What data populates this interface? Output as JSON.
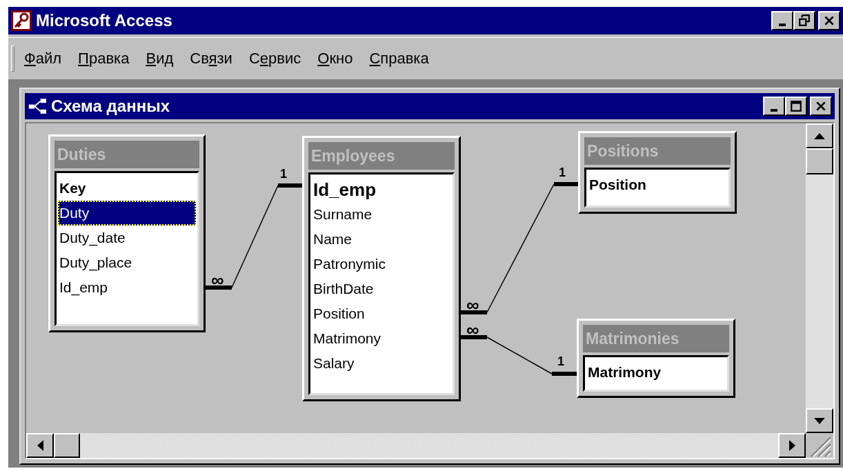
{
  "window": {
    "title": "Microsoft Access"
  },
  "menu": [
    {
      "key": "Ф",
      "post": "айл"
    },
    {
      "key": "П",
      "post": "равка"
    },
    {
      "key": "В",
      "post": "ид"
    },
    {
      "pre": "Св",
      "key": "я",
      "post": "зи"
    },
    {
      "pre": "С",
      "key": "е",
      "post": "рвис"
    },
    {
      "key": "О",
      "post": "кно"
    },
    {
      "key": "С",
      "post": "правка"
    }
  ],
  "child_window": {
    "title": "Схема данных"
  },
  "tables": [
    {
      "name": "Duties",
      "fields": [
        {
          "name": "Key",
          "primary": true,
          "selected": false
        },
        {
          "name": "Duty",
          "primary": false,
          "selected": true
        },
        {
          "name": "Duty_date",
          "primary": false,
          "selected": false
        },
        {
          "name": "Duty_place",
          "primary": false,
          "selected": false
        },
        {
          "name": "Id_emp",
          "primary": false,
          "selected": false
        }
      ]
    },
    {
      "name": "Employees",
      "fields": [
        {
          "name": "Id_emp",
          "primary": true,
          "selected": false
        },
        {
          "name": "Surname",
          "primary": false,
          "selected": false
        },
        {
          "name": "Name",
          "primary": false,
          "selected": false
        },
        {
          "name": "Patronymic",
          "primary": false,
          "selected": false
        },
        {
          "name": "BirthDate",
          "primary": false,
          "selected": false
        },
        {
          "name": "Position",
          "primary": false,
          "selected": false
        },
        {
          "name": "Matrimony",
          "primary": false,
          "selected": false
        },
        {
          "name": "Salary",
          "primary": false,
          "selected": false
        }
      ]
    },
    {
      "name": "Positions",
      "fields": [
        {
          "name": "Position",
          "primary": true,
          "selected": false
        }
      ]
    },
    {
      "name": "Matrimonies",
      "fields": [
        {
          "name": "Matrimony",
          "primary": true,
          "selected": false
        }
      ]
    }
  ],
  "relationships": [
    {
      "many_label": "∞",
      "one_label": "1"
    },
    {
      "many_label": "∞",
      "one_label": "1"
    },
    {
      "many_label": "∞",
      "one_label": "1"
    }
  ]
}
